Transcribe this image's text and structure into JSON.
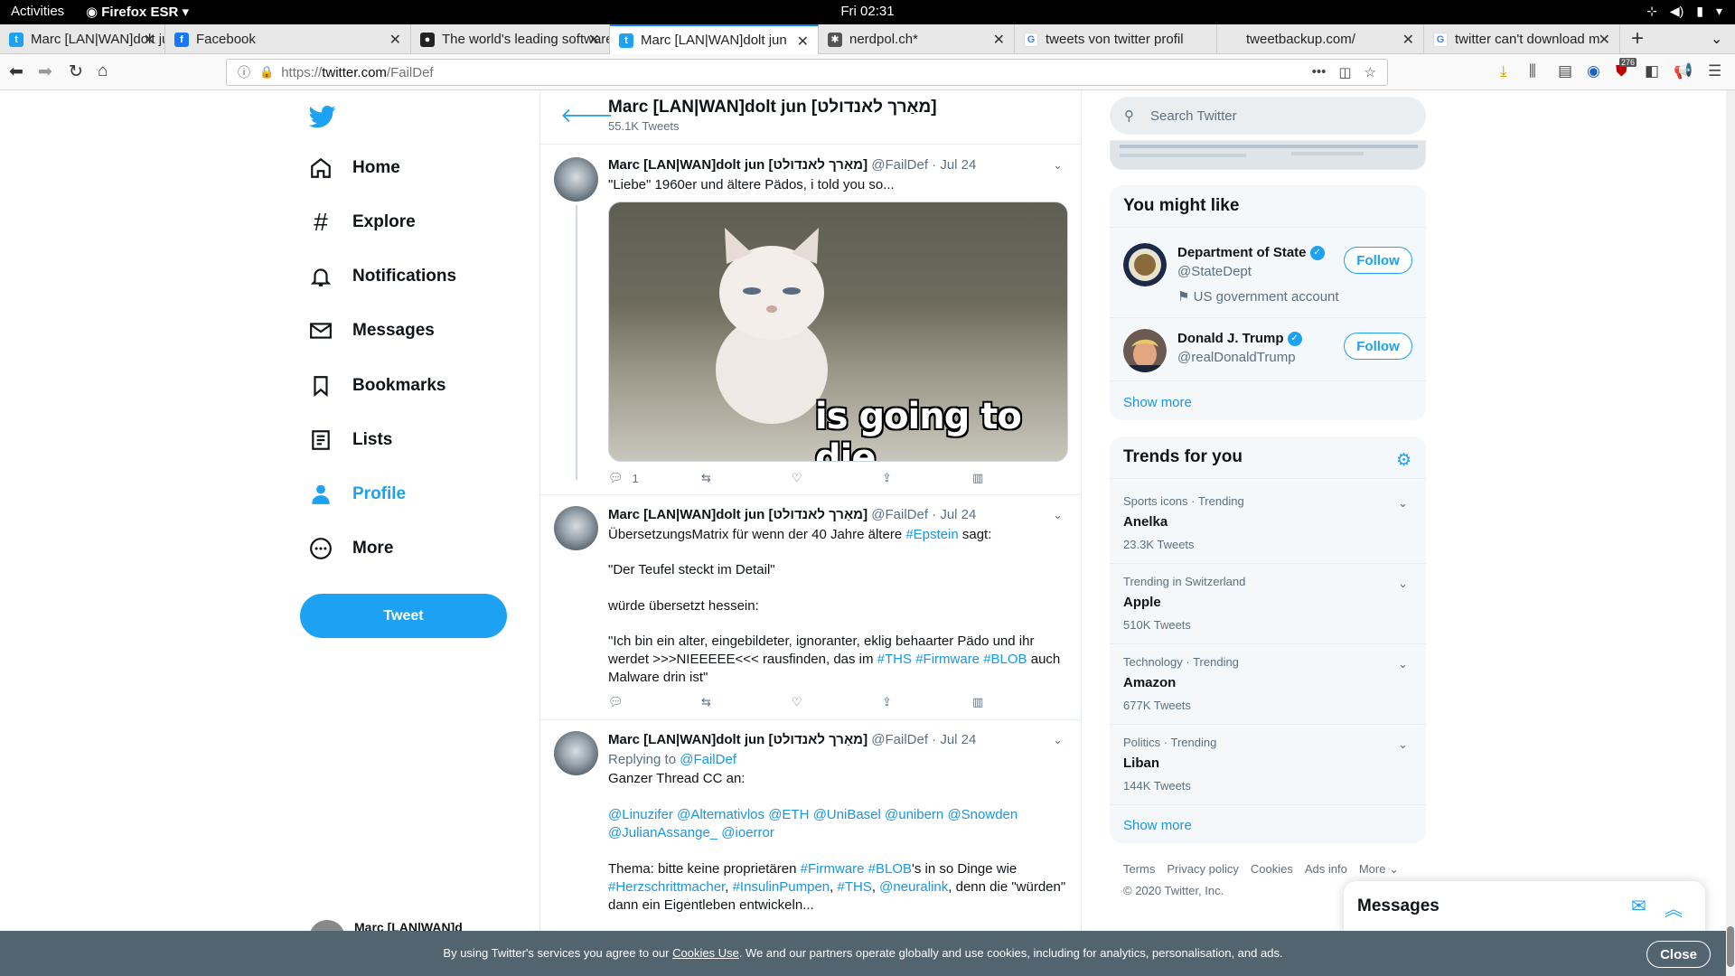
{
  "system": {
    "activities": "Activities",
    "app": "Firefox ESR",
    "clock": "Fri 02:31"
  },
  "tabs": [
    {
      "title": "Marc [LAN|WAN]dolt jun",
      "icon": "twitter-icon"
    },
    {
      "title": "Facebook",
      "icon": "facebook-icon"
    },
    {
      "title": "The world's leading software",
      "icon": "github-icon"
    },
    {
      "title": "Marc [LAN|WAN]dolt jun",
      "icon": "twitter-icon"
    },
    {
      "title": "nerdpol.ch*",
      "icon": "diaspora-icon"
    },
    {
      "title": "tweets von twitter profil",
      "icon": "google-icon"
    },
    {
      "title": "tweetbackup.com/",
      "icon": "none"
    },
    {
      "title": "twitter can't download m",
      "icon": "google-icon"
    }
  ],
  "urlbar": {
    "prefix": "https://",
    "domain": "twitter.com",
    "path": "/FailDef"
  },
  "toolbar": {
    "badge": "276"
  },
  "sidebar": {
    "items": [
      {
        "label": "Home",
        "icon": "home-icon"
      },
      {
        "label": "Explore",
        "icon": "hashtag-icon"
      },
      {
        "label": "Notifications",
        "icon": "bell-icon"
      },
      {
        "label": "Messages",
        "icon": "envelope-icon"
      },
      {
        "label": "Bookmarks",
        "icon": "bookmark-icon"
      },
      {
        "label": "Lists",
        "icon": "list-icon"
      },
      {
        "label": "Profile",
        "icon": "profile-icon"
      },
      {
        "label": "More",
        "icon": "more-icon"
      }
    ],
    "tweet_label": "Tweet",
    "account_name": "Marc [LAN|WAN]d"
  },
  "header": {
    "name": "Marc [LAN|WAN]dolt jun [מאַרך לאנדולט]",
    "count": "55.1K Tweets"
  },
  "tweets": [
    {
      "name": "Marc [LAN|WAN]dolt jun [מאַרך לאנדולט]",
      "handle": "@FailDef",
      "date": "Jul 24",
      "text": "\"Liebe\" 1960er und ältere Pädos, i told you so...",
      "image_caption": "is going to die",
      "replies": "1"
    },
    {
      "name": "Marc [LAN|WAN]dolt jun [מאַרך לאנדולט]",
      "handle": "@FailDef",
      "date": "Jul 24",
      "l1a": "ÜbersetzungsMatrix für wenn der 40 Jahre ältere ",
      "l1b": "#Epstein",
      "l1c": " sagt:",
      "l2": "\"Der Teufel steckt im Detail\"",
      "l3": "würde übersetzt hessein:",
      "l4": "\"Ich bin ein alter, eingebildeter, ignoranter, eklig behaarter Pädo und ihr werdet >>>NIEEEEE<<< rausfinden, das im ",
      "l4t1": "#THS",
      "l4t2": "#Firmware",
      "l4t3": "#BLOB",
      "l4e": " auch Malware drin ist\""
    },
    {
      "name": "Marc [LAN|WAN]dolt jun [מאַרך לאנדולט]",
      "handle": "@FailDef",
      "date": "Jul 24",
      "replying": "Replying to ",
      "replying_handle": "@FailDef",
      "l1": "Ganzer Thread CC an:",
      "mentions1": "@Linuzifer @Alternativlos @ETH @UniBasel @unibern @Snowden",
      "mentions2": "@JulianAssange_ @ioerror",
      "l3a": "Thema: bitte keine proprietären ",
      "l3t1": "#Firmware",
      "l3t2": "#BLOB",
      "l3b": "'s in so Dinge wie",
      "l4t1": "#Herzschrittmacher",
      "l4t2": "#InsulinPumpen",
      "l4t3": "#THS",
      "l4t4": "@neuralink",
      "l4b": ", denn die \"würden\"",
      "l5": "dann ein Eigentleben entwickeln..."
    }
  ],
  "search": {
    "placeholder": "Search Twitter"
  },
  "who_to_follow": {
    "title": "You might like",
    "users": [
      {
        "name": "Department of State",
        "handle": "@StateDept",
        "note": "US government account",
        "button": "Follow"
      },
      {
        "name": "Donald J. Trump",
        "handle": "@realDonaldTrump",
        "button": "Follow"
      }
    ],
    "show_more": "Show more"
  },
  "trends": {
    "title": "Trends for you",
    "items": [
      {
        "context": "Sports icons · Trending",
        "name": "Anelka",
        "count": "23.3K Tweets"
      },
      {
        "context": "Trending in Switzerland",
        "name": "Apple",
        "count": "510K Tweets"
      },
      {
        "context": "Technology · Trending",
        "name": "Amazon",
        "count": "677K Tweets"
      },
      {
        "context": "Politics · Trending",
        "name": "Liban",
        "count": "144K Tweets"
      }
    ],
    "show_more": "Show more"
  },
  "footer": {
    "terms": "Terms",
    "privacy": "Privacy policy",
    "cookies": "Cookies",
    "ads": "Ads info",
    "more": "More",
    "copyright": "© 2020 Twitter, Inc."
  },
  "messages_dock": {
    "title": "Messages"
  },
  "cookie_bar": {
    "pre": "By using Twitter's services you agree to our ",
    "link": "Cookies Use",
    "post": ". We and our partners operate globally and use cookies, including for analytics, personalisation, and ads.",
    "close": "Close"
  },
  "colors": {
    "accent": "#1da1f2",
    "link": "#1b95e0",
    "cookie_bar": "#536471"
  }
}
